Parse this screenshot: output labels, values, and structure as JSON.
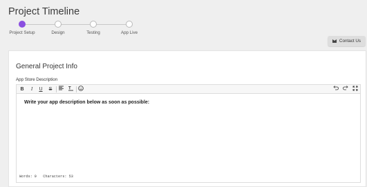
{
  "page": {
    "title": "Project Timeline"
  },
  "stepper": {
    "steps": [
      {
        "label": "Project Setup"
      },
      {
        "label": "Design"
      },
      {
        "label": "Testing"
      },
      {
        "label": "App Live"
      }
    ],
    "active_index": 0,
    "active_color": "#8a4fe0"
  },
  "header": {
    "contact_label": "Contact Us"
  },
  "section": {
    "title": "General Project Info"
  },
  "field": {
    "label": "App Store Description"
  },
  "editor": {
    "toolbar": {
      "bold": "B",
      "italic": "I",
      "underline": "U",
      "strikethrough": "S"
    },
    "content": "Write your app description below as soon as possible:",
    "word_count_label": "Words: 9   Characters: 53"
  }
}
